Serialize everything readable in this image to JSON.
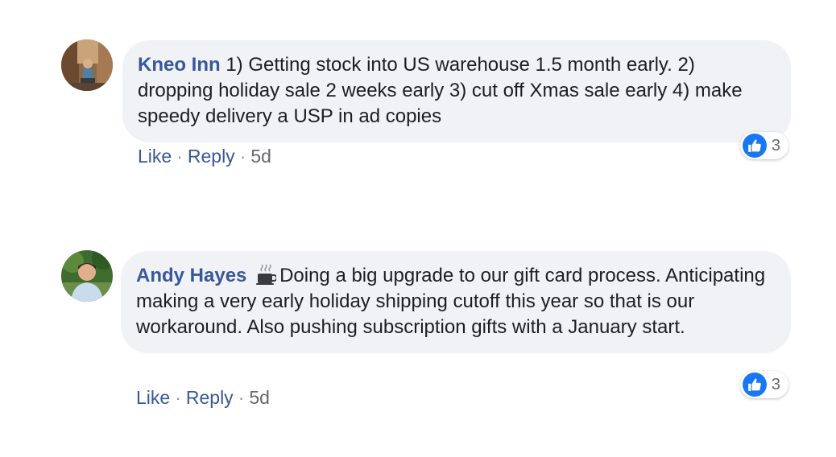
{
  "comments": [
    {
      "author": "Kneo Inn",
      "text": " 1) Getting stock into US warehouse 1.5 month early. 2) dropping holiday sale 2 weeks early 3) cut off Xmas sale early 4) make speedy delivery a USP in ad copies",
      "reactions_count": "3",
      "like_label": "Like",
      "reply_label": "Reply",
      "separator": "·",
      "time": "5d"
    },
    {
      "author": "Andy Hayes",
      "text": "Doing a big upgrade to our gift card process. Anticipating making a very early holiday shipping cutoff this year so that is our workaround. Also pushing subscription gifts with a January start.",
      "reactions_count": "3",
      "like_label": "Like",
      "reply_label": "Reply",
      "separator": "·",
      "time": "5d"
    }
  ],
  "colors": {
    "author": "#385898",
    "bubble": "#f0f2f5",
    "like_badge": "#1877f2",
    "meta": "#65676b"
  },
  "icons": {
    "author_badge": "mug-icon",
    "reaction": "thumbs-up-icon"
  }
}
